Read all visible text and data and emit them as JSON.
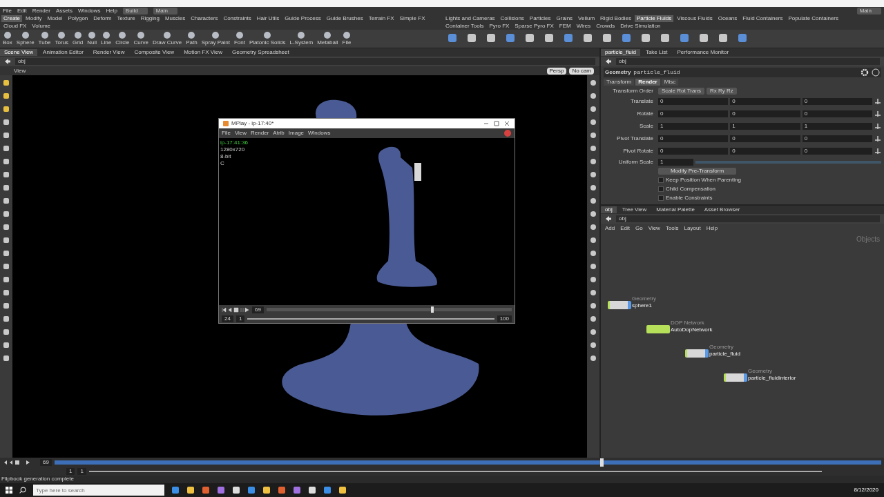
{
  "menu": [
    "File",
    "Edit",
    "Render",
    "Assets",
    "Windows",
    "Help"
  ],
  "desktop": "Build",
  "main_desktop": "Main",
  "right_desktop": "Main",
  "shelf_tabs_left": [
    {
      "label": "Create",
      "selected": true
    },
    {
      "label": "Modify",
      "selected": false
    },
    {
      "label": "Model",
      "selected": false
    },
    {
      "label": "Polygon",
      "selected": false
    },
    {
      "label": "Deform",
      "selected": false
    },
    {
      "label": "Texture",
      "selected": false
    },
    {
      "label": "Rigging",
      "selected": false
    },
    {
      "label": "Muscles",
      "selected": false
    },
    {
      "label": "Characters",
      "selected": false
    },
    {
      "label": "Constraints",
      "selected": false
    },
    {
      "label": "Hair Utils",
      "selected": false
    },
    {
      "label": "Guide Process",
      "selected": false
    },
    {
      "label": "Guide Brushes",
      "selected": false
    },
    {
      "label": "Terrain FX",
      "selected": false
    },
    {
      "label": "Simple FX",
      "selected": false
    },
    {
      "label": "Cloud FX",
      "selected": false
    },
    {
      "label": "Volume",
      "selected": false
    }
  ],
  "shelf_tools_left": [
    "Box",
    "Sphere",
    "Tube",
    "Torus",
    "Grid",
    "Null",
    "Line",
    "Circle",
    "Curve",
    "Draw Curve",
    "Path",
    "Spray Paint",
    "Font",
    "Platonic Solids",
    "L-System",
    "Metaball",
    "File"
  ],
  "shelf_tabs_right": [
    {
      "label": "Lights and Cameras",
      "selected": false
    },
    {
      "label": "Collisions",
      "selected": false
    },
    {
      "label": "Particles",
      "selected": false
    },
    {
      "label": "Grains",
      "selected": false
    },
    {
      "label": "Vellum",
      "selected": false
    },
    {
      "label": "Rigid Bodies",
      "selected": false
    },
    {
      "label": "Particle Fluids",
      "selected": true
    },
    {
      "label": "Viscous Fluids",
      "selected": false
    },
    {
      "label": "Oceans",
      "selected": false
    },
    {
      "label": "Fluid Containers",
      "selected": false
    },
    {
      "label": "Populate Containers",
      "selected": false
    },
    {
      "label": "Container Tools",
      "selected": false
    },
    {
      "label": "Pyro FX",
      "selected": false
    },
    {
      "label": "Sparse Pyro FX",
      "selected": false
    },
    {
      "label": "FEM",
      "selected": false
    },
    {
      "label": "Wires",
      "selected": false
    },
    {
      "label": "Crowds",
      "selected": false
    },
    {
      "label": "Drive Simulation",
      "selected": false
    }
  ],
  "pane_tabs_left": [
    {
      "label": "Scene View",
      "selected": true
    },
    {
      "label": "Animation Editor",
      "selected": false
    },
    {
      "label": "Render View",
      "selected": false
    },
    {
      "label": "Composite View",
      "selected": false
    },
    {
      "label": "Motion FX View",
      "selected": false
    },
    {
      "label": "Geometry Spreadsheet",
      "selected": false
    }
  ],
  "pane_tabs_right": [
    {
      "label": "particle_fluid",
      "selected": true
    },
    {
      "label": "Take List",
      "selected": false
    },
    {
      "label": "Performance Monitor",
      "selected": false
    }
  ],
  "path_left": "obj",
  "path_right": "obj",
  "viewport": {
    "label": "View",
    "camera": "Persp",
    "cam_menu": "No cam"
  },
  "mplay": {
    "title": "MPlay - ip-17:40*",
    "menu": [
      "File",
      "View",
      "Render",
      "Atrib",
      "Image",
      "Windows"
    ],
    "info": [
      "ip-17:41:36",
      "1280x720",
      "8-bit",
      "C"
    ],
    "frame": "69",
    "fps": "24",
    "start": "1",
    "end": "100",
    "level": 0.67
  },
  "params": {
    "type": "Geometry",
    "name": "particle_fluid",
    "tabs": [
      {
        "label": "Transform",
        "selected": false
      },
      {
        "label": "Render",
        "selected": true
      },
      {
        "label": "Misc",
        "selected": false
      }
    ],
    "order_label": "Transform Order",
    "order": [
      "Scale Rot Trans",
      "Rx Ry Rz"
    ],
    "rows": [
      {
        "label": "Translate",
        "values": [
          "0",
          "0",
          "0"
        ]
      },
      {
        "label": "Rotate",
        "values": [
          "0",
          "0",
          "0"
        ]
      },
      {
        "label": "Scale",
        "values": [
          "1",
          "1",
          "1"
        ]
      },
      {
        "label": "Pivot Translate",
        "values": [
          "0",
          "0",
          "0"
        ]
      },
      {
        "label": "Pivot Rotate",
        "values": [
          "0",
          "0",
          "0"
        ]
      }
    ],
    "uniform_label": "Uniform Scale",
    "uniform_value": "1",
    "uniform_slider": {
      "level": 1
    },
    "modify_button": "Modify Pre-Transform",
    "checkboxes": [
      {
        "label": "Keep Position When Parenting",
        "checked": false
      },
      {
        "label": "Child Compensation",
        "checked": false
      },
      {
        "label": "Enable Constraints",
        "checked": false
      }
    ]
  },
  "network": {
    "tabs": [
      {
        "label": "obj",
        "selected": true
      },
      {
        "label": "Tree View",
        "selected": false
      },
      {
        "label": "Material Palette",
        "selected": false
      },
      {
        "label": "Asset Browser",
        "selected": false
      }
    ],
    "path": "obj",
    "menu": [
      "Add",
      "Edit",
      "Go",
      "View",
      "Tools",
      "Layout",
      "Help"
    ],
    "context": "Objects",
    "nodes": [
      {
        "type": "Geometry",
        "name": "sphere1",
        "kind": "geo"
      },
      {
        "type": "DOP Network",
        "name": "AutoDopNetwork",
        "kind": "dop"
      },
      {
        "type": "Geometry",
        "name": "particle_fluid",
        "kind": "geo"
      },
      {
        "type": "Geometry",
        "name": "particle_fluidinterior",
        "kind": "geo"
      }
    ]
  },
  "timeline": {
    "frame": "69",
    "start": "1",
    "end": "1",
    "level": 0.66
  },
  "status": "Flipbook generation complete",
  "taskbar": {
    "search_placeholder": "Type here to search",
    "date": "8/12/2020"
  }
}
